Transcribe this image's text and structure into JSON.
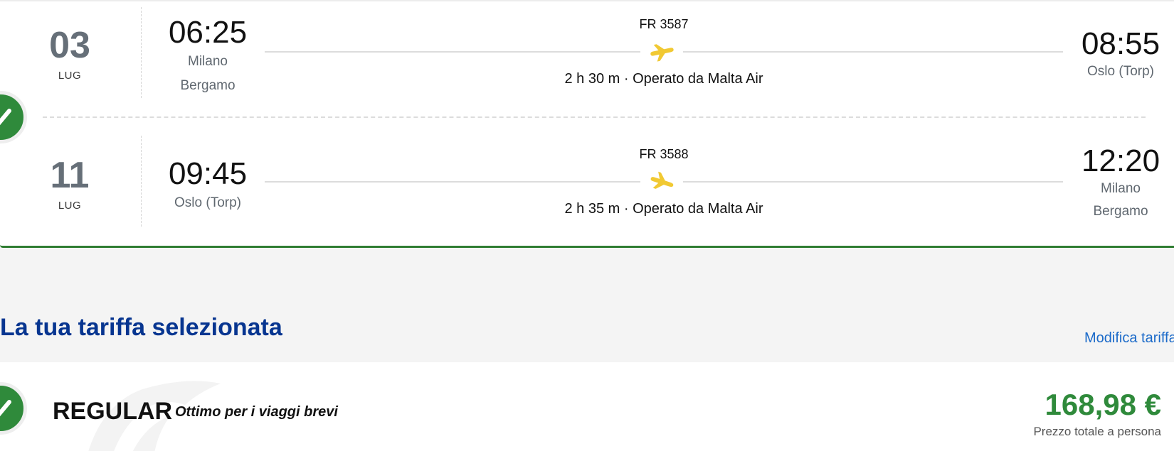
{
  "outbound": {
    "day": "03",
    "month": "LUG",
    "dep_time": "06:25",
    "dep_city_line1": "Milano",
    "dep_city_line2": "Bergamo",
    "flight_number": "FR 3587",
    "duration": "2 h 30 m · Operato da Malta Air",
    "arr_time": "08:55",
    "arr_city_line1": "Oslo (Torp)"
  },
  "inbound": {
    "day": "11",
    "month": "LUG",
    "dep_time": "09:45",
    "dep_city_line1": "Oslo (Torp)",
    "flight_number": "FR 3588",
    "duration": "2 h 35 m · Operato da Malta Air",
    "arr_time": "12:20",
    "arr_city_line1": "Milano",
    "arr_city_line2": "Bergamo"
  },
  "fare_section": {
    "title": "La tua tariffa selezionata",
    "modify_link": "Modifica tariffa"
  },
  "fare": {
    "name": "REGULAR",
    "tagline": "Ottimo per i viaggi brevi",
    "price": "168,98 €",
    "price_note": "Prezzo totale a persona"
  },
  "icons": {
    "plane": "airplane-icon",
    "check": "checkmark-icon"
  },
  "colors": {
    "brand_blue": "#073590",
    "confirm_green": "#2f8a3b",
    "plane_yellow": "#f1c933",
    "link_blue": "#1b6ac9"
  }
}
